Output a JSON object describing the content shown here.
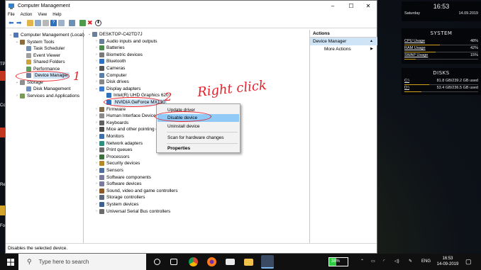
{
  "window": {
    "title": "Computer Management",
    "menu": [
      "File",
      "Action",
      "View",
      "Help"
    ],
    "controls": {
      "minimize": "–",
      "maximize": "☐",
      "close": "✕"
    }
  },
  "left_tree": [
    {
      "label": "Computer Management (Local)",
      "level": 0,
      "icon": "computer-management-icon",
      "expanded": true
    },
    {
      "label": "System Tools",
      "level": 1,
      "icon": "tools-icon",
      "expanded": true
    },
    {
      "label": "Task Scheduler",
      "level": 2,
      "icon": "clock-icon"
    },
    {
      "label": "Event Viewer",
      "level": 2,
      "icon": "event-viewer-icon"
    },
    {
      "label": "Shared Folders",
      "level": 2,
      "icon": "shared-folder-icon"
    },
    {
      "label": "Performance",
      "level": 2,
      "icon": "performance-icon"
    },
    {
      "label": "Device Manager",
      "level": 2,
      "icon": "device-manager-icon",
      "selected": true
    },
    {
      "label": "Storage",
      "level": 1,
      "icon": "storage-icon",
      "expanded": true
    },
    {
      "label": "Disk Management",
      "level": 2,
      "icon": "disk-management-icon"
    },
    {
      "label": "Services and Applications",
      "level": 1,
      "icon": "services-icon"
    }
  ],
  "device_tree": {
    "root": "DESKTOP-C42TD7J",
    "items": [
      {
        "label": "Audio inputs and outputs",
        "icon": "audio-icon"
      },
      {
        "label": "Batteries",
        "icon": "battery-icon"
      },
      {
        "label": "Biometric devices",
        "icon": "biometric-icon"
      },
      {
        "label": "Bluetooth",
        "icon": "bluetooth-icon"
      },
      {
        "label": "Cameras",
        "icon": "camera-icon"
      },
      {
        "label": "Computer",
        "icon": "computer-icon"
      },
      {
        "label": "Disk drives",
        "icon": "disk-drive-icon"
      },
      {
        "label": "Display adapters",
        "icon": "display-adapter-icon",
        "expanded": true,
        "children": [
          {
            "label": "Intel(R) UHD Graphics 620",
            "icon": "display-adapter-icon"
          },
          {
            "label": "NVIDIA GeForce MX130",
            "icon": "display-adapter-icon",
            "selected": true
          }
        ]
      },
      {
        "label": "Firmware",
        "icon": "firmware-icon"
      },
      {
        "label": "Human Interface Devices",
        "icon": "hid-icon"
      },
      {
        "label": "Keyboards",
        "icon": "keyboard-icon"
      },
      {
        "label": "Mice and other pointing devices",
        "icon": "mouse-icon"
      },
      {
        "label": "Monitors",
        "icon": "monitor-icon"
      },
      {
        "label": "Network adapters",
        "icon": "network-icon"
      },
      {
        "label": "Print queues",
        "icon": "printer-icon"
      },
      {
        "label": "Processors",
        "icon": "processor-icon"
      },
      {
        "label": "Security devices",
        "icon": "security-icon"
      },
      {
        "label": "Sensors",
        "icon": "sensor-icon"
      },
      {
        "label": "Software components",
        "icon": "software-icon"
      },
      {
        "label": "Software devices",
        "icon": "software-icon"
      },
      {
        "label": "Sound, video and game controllers",
        "icon": "sound-icon"
      },
      {
        "label": "Storage controllers",
        "icon": "storage-controller-icon"
      },
      {
        "label": "System devices",
        "icon": "system-icon"
      },
      {
        "label": "Universal Serial Bus controllers",
        "icon": "usb-icon"
      }
    ]
  },
  "context_menu": {
    "items": [
      "Update driver",
      "Disable device",
      "Uninstall device",
      "Scan for hardware changes",
      "Properties"
    ],
    "highlighted": "Disable device"
  },
  "actions": {
    "header": "Actions",
    "section": "Device Manager",
    "items": [
      "More Actions"
    ]
  },
  "status_bar": "Disables the selected device.",
  "annotations": {
    "step1": "1",
    "step2": "2",
    "right_click": "Right click"
  },
  "desktop_labels": [
    "TP",
    "Cor",
    "Re",
    "Fo"
  ],
  "rainmeter": {
    "clock": {
      "time": "16:53",
      "day": "Saturday",
      "date": "14.09.2019"
    },
    "system": {
      "title": "SYSTEM",
      "rows": [
        {
          "label": "CPU Usage",
          "value": "48%",
          "level": 0.48
        },
        {
          "label": "RAM Usage",
          "value": "42%",
          "level": 0.42
        },
        {
          "label": "SWAP Usage",
          "value": "15%",
          "level": 0.15
        }
      ]
    },
    "disks": {
      "title": "DISKS",
      "rows": [
        {
          "label": "C:\\",
          "value": "81.8 GB/239.2 GB used",
          "level": 0.34
        },
        {
          "label": "D:\\",
          "value": "53.4 GB/236.5 GB used",
          "level": 0.23
        }
      ]
    }
  },
  "taskbar": {
    "search_placeholder": "Type here to search",
    "battery": "38%",
    "language": "ENG",
    "time": "16:53",
    "date": "14-09-2019"
  },
  "colors": {
    "selection": "#cfe4f7",
    "annotation": "#e8202a",
    "taskbar": "#101010",
    "rainmeter_accent": "#d3a21d"
  }
}
